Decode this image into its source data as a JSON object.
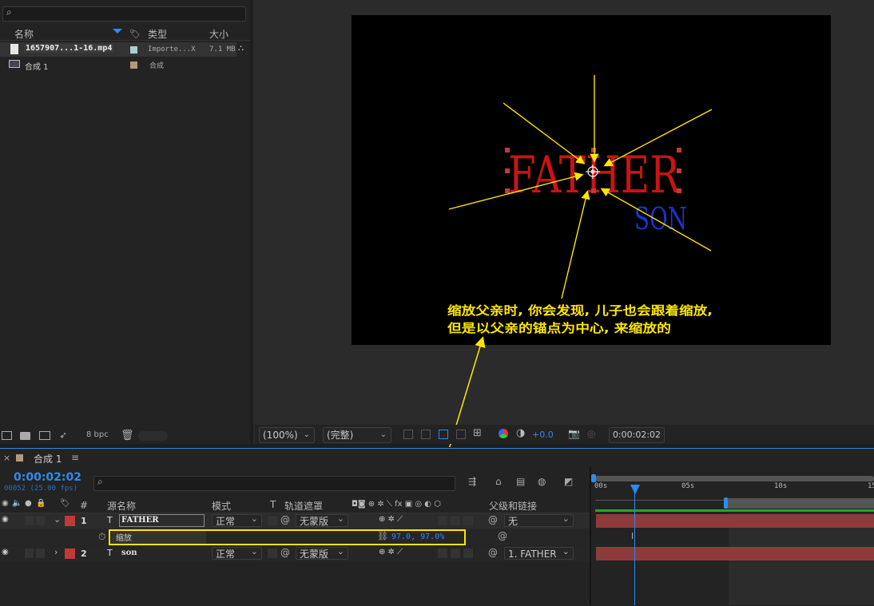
{
  "project": {
    "search_placeholder": "",
    "columns": {
      "name": "名称",
      "type": "类型",
      "size": "大小"
    },
    "items": [
      {
        "name": "1657907...1-16.mp4",
        "type": "Importe...X",
        "size": "7.1 MB",
        "swatch": "#a9d1d1"
      },
      {
        "name": "合成 1",
        "type": "合成",
        "size": "",
        "swatch": "#b49a7a"
      }
    ],
    "bpc": "8 bpc"
  },
  "viewer": {
    "zoom": "(100%)",
    "resolution": "(完整)",
    "exposure": "+0.0",
    "timecode": "0:00:02:02",
    "canvas": {
      "father_text": "FATHER",
      "son_text": "SON",
      "annotation_line1": "缩放父亲时, 你会发现, 儿子也会跟着缩放,",
      "annotation_line2": "但是以父亲的锚点为中心, 来缩放的"
    }
  },
  "timeline": {
    "comp_tab": "合成 1",
    "timecode": "0:00:02:02",
    "frame_info": "00052 (25.00 fps)",
    "columns": {
      "num": "#",
      "source_name": "源名称",
      "mode": "模式",
      "t": "T",
      "trackmatte": "轨道遮罩",
      "parent": "父级和链接"
    },
    "ruler": [
      "00s",
      "05s",
      "10s",
      "15"
    ],
    "layers": [
      {
        "num": "1",
        "name": "FATHER",
        "mode": "正常",
        "matte": "无蒙版",
        "parent": "无",
        "color": "#c13a3a"
      },
      {
        "num": "2",
        "name": "son",
        "mode": "正常",
        "matte": "无蒙版",
        "parent": "1. FATHER",
        "color": "#c13a3a"
      }
    ],
    "property": {
      "name": "缩放",
      "value": "97.0, 97.0%"
    }
  },
  "colors": {
    "accent": "#2d8ceb",
    "annotation": "#ffe600",
    "father": "#c81414",
    "son": "#1a33cc"
  }
}
